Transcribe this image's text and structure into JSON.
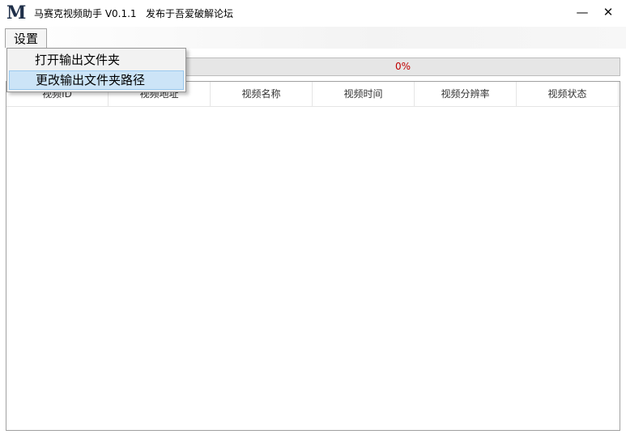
{
  "window": {
    "logo_text": "M",
    "title": "马赛克视频助手 V0.1.1   发布于吾爱破解论坛",
    "minimize_glyph": "—",
    "close_glyph": "✕"
  },
  "menubar": {
    "settings_label": "设置"
  },
  "dropdown": {
    "items": [
      {
        "label": "打开输出文件夹"
      },
      {
        "label": "更改输出文件夹路径",
        "highlighted": true
      }
    ]
  },
  "progress": {
    "label": "0%",
    "value": 0,
    "text_color": "#c00000"
  },
  "table": {
    "columns": [
      "视频ID",
      "视频地址",
      "视频名称",
      "视频时间",
      "视频分辨率",
      "视频状态"
    ],
    "rows": []
  },
  "colors": {
    "menu_highlight": "#cce4f7",
    "menu_highlight_border": "#99c9ef"
  }
}
